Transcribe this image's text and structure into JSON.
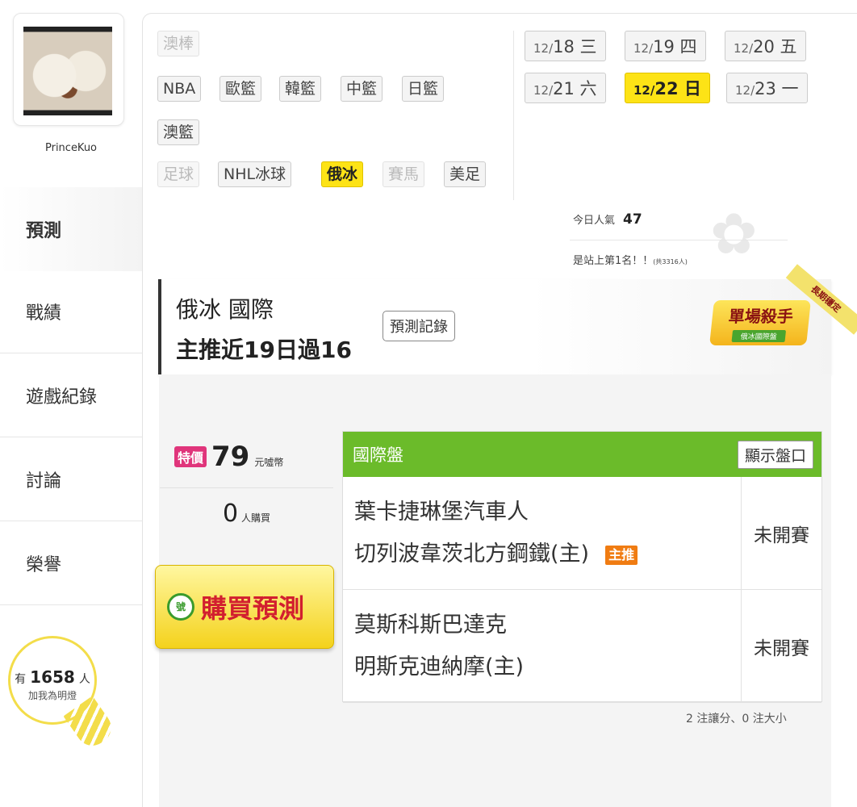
{
  "user": {
    "name": "PrinceKuo",
    "avatar_icon": "steamed-bun-photo"
  },
  "nav": [
    {
      "label": "預測",
      "active": true
    },
    {
      "label": "戰績",
      "active": false
    },
    {
      "label": "遊戲紀錄",
      "active": false
    },
    {
      "label": "討論",
      "active": false
    },
    {
      "label": "榮譽",
      "active": false
    }
  ],
  "fans": {
    "prefix": "有",
    "count": "1658",
    "suffix": "人",
    "text": "加我為明燈"
  },
  "leagues": [
    {
      "label": "澳棒",
      "state": "dim"
    },
    {
      "label": "NBA",
      "state": "normal"
    },
    {
      "label": "歐籃",
      "state": "normal"
    },
    {
      "label": "韓籃",
      "state": "normal"
    },
    {
      "label": "中籃",
      "state": "normal"
    },
    {
      "label": "日籃",
      "state": "normal"
    },
    {
      "label": "澳籃",
      "state": "normal"
    },
    {
      "label": "足球",
      "state": "dim"
    },
    {
      "label": "NHL冰球",
      "state": "normal"
    },
    {
      "label": "俄冰",
      "state": "selected"
    },
    {
      "label": "賽馬",
      "state": "dim"
    },
    {
      "label": "美足",
      "state": "normal"
    }
  ],
  "dates": [
    {
      "md": "12/",
      "day": "18 三",
      "selected": false
    },
    {
      "md": "12/",
      "day": "19 四",
      "selected": false
    },
    {
      "md": "12/",
      "day": "20 五",
      "selected": false
    },
    {
      "md": "12/",
      "day": "21 六",
      "selected": false
    },
    {
      "md": "12/",
      "day": "22 日",
      "selected": true
    },
    {
      "md": "12/",
      "day": "23 一",
      "selected": false
    }
  ],
  "popularity": {
    "label": "今日人氣",
    "value": "47",
    "rank_text": "是站上第1名！！",
    "rank_note": "(共3316人)"
  },
  "heading": {
    "line1": "俄冰 國際",
    "line2": "主推近19日過16",
    "record_button": "預測記錄"
  },
  "badge": {
    "title": "單場殺手",
    "subtitle": "俄冰國際盤",
    "ribbon": "長期穩定"
  },
  "purchase": {
    "special_label": "特價",
    "price": "79",
    "unit": "元噓幣",
    "buyers": "0",
    "buyers_unit": "人購買",
    "buy_label": "購買預測",
    "buy_icon": "ticket-icon"
  },
  "table": {
    "header": "國際盤",
    "show_button": "顯示盤口",
    "rows": [
      {
        "team1": "葉卡捷琳堡汽車人",
        "team2": "切列波韋茨北方鋼鐵(主)",
        "tag": "主推",
        "status": "未開賽"
      },
      {
        "team1": "莫斯科斯巴達克",
        "team2": "明斯克迪納摩(主)",
        "tag": "",
        "status": "未開賽"
      }
    ]
  },
  "summary": "2 注讓分、0 注大小",
  "colors": {
    "accent_yellow": "#fde316",
    "header_green": "#6bbb2a",
    "special_pink": "#e0357b",
    "tag_orange": "#f07c12"
  }
}
